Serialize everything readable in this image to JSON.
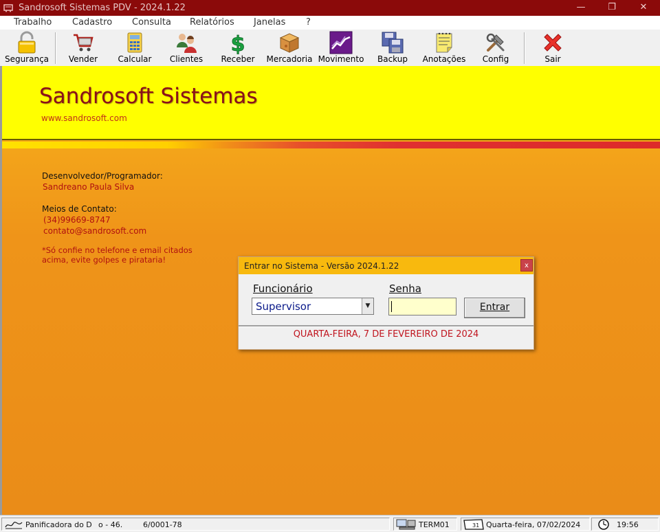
{
  "window": {
    "title": "Sandrosoft Sistemas PDV - 2024.1.22",
    "minimize": "—",
    "restore": "❐",
    "close": "✕"
  },
  "menu": [
    "Trabalho",
    "Cadastro",
    "Consulta",
    "Relatórios",
    "Janelas",
    "?"
  ],
  "toolbar": {
    "seguranca": "Segurança",
    "vender": "Vender",
    "calcular": "Calcular",
    "clientes": "Clientes",
    "receber": "Receber",
    "mercadoria": "Mercadoria",
    "movimento": "Movimento",
    "backup": "Backup",
    "anotacoes": "Anotações",
    "config": "Config",
    "sair": "Sair"
  },
  "banner": {
    "company": "Sandrosoft Sistemas",
    "website": "www.sandrosoft.com"
  },
  "info": {
    "dev_label": "Desenvolvedor/Programador:",
    "dev_name": "Sandreano Paula Silva",
    "contact_label": "Meios de Contato:",
    "phone": "(34)99669-8747",
    "email": "contato@sandrosoft.com",
    "warning_line1": "*Só confie no telefone e email citados",
    "warning_line2": "acima, evite golpes e pirataria!"
  },
  "login": {
    "title": "Entrar no Sistema - Versão 2024.1.22",
    "close": "x",
    "employee_label": "Funcionário",
    "employee_value": "Supervisor",
    "password_label": "Senha",
    "password_value": "",
    "button": "Entrar",
    "date": "QUARTA-FEIRA, 7 DE FEVEREIRO DE 2024"
  },
  "status": {
    "company_a": "Panificadora do D",
    "company_b": "o - 46.",
    "company_c": "6/0001-78",
    "terminal": "TERM01",
    "date": "Quarta-feira, 07/02/2024",
    "time": "19:56"
  },
  "colors": {
    "titlebar": "#8b0a0a",
    "banner": "#ffff00",
    "background_orange": "#ea8c18",
    "brand_text": "#8b0f1a",
    "dialog_title": "#f8b90e",
    "date_red": "#c0141e"
  }
}
